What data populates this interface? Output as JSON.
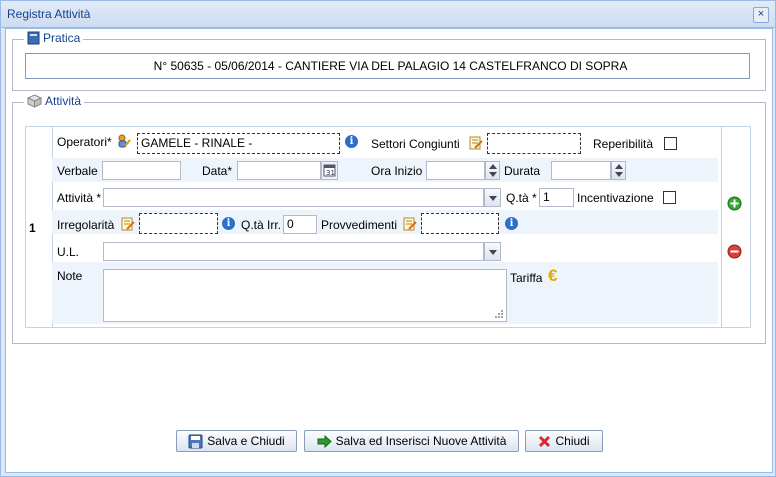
{
  "window": {
    "title": "Registra Attività",
    "close_glyph": "×"
  },
  "pratica": {
    "legend": "Pratica",
    "value": "N° 50635 - 05/06/2014 - CANTIERE VIA DEL PALAGIO  14 CASTELFRANCO DI SOPRA"
  },
  "attivita_section": {
    "legend": "Attività",
    "row_number": "1",
    "fields": {
      "operatori_label": "Operatori*",
      "operatori_value": "GAMELE - RINALE -",
      "settori_label": "Settori Congiunti",
      "settori_value": "",
      "reperibilita_label": "Reperibilità",
      "verbale_label": "Verbale",
      "verbale_value": "",
      "data_label": "Data*",
      "data_value": "",
      "ora_inizio_label": "Ora Inizio",
      "ora_inizio_value": "",
      "durata_label": "Durata",
      "durata_value": "",
      "attivita_label": "Attività *",
      "attivita_value": "",
      "qta_label": "Q.tà *",
      "qta_value": "1",
      "incentivazione_label": "Incentivazione",
      "irregolarita_label": "Irregolarità",
      "irregolarita_value": "",
      "qta_irr_label": "Q.tà Irr.",
      "qta_irr_value": "0",
      "provvedimenti_label": "Provvedimenti",
      "provvedimenti_value": "",
      "ul_label": "U.L.",
      "ul_value": "",
      "note_label": "Note",
      "note_value": "",
      "tariffa_label": "Tariffa",
      "tariffa_glyph": "€"
    },
    "checkbox_states": {
      "reperibilita": false,
      "incentivazione": false
    }
  },
  "buttons": {
    "save_close": "Salva e Chiudi",
    "save_insert": "Salva ed Inserisci Nuove Attività",
    "close": "Chiudi"
  },
  "colors": {
    "title_text": "#15428b",
    "add": "#3aa33a",
    "remove": "#d9413a",
    "close_x": "#d42a2a",
    "arrow": "#2a9a2a",
    "tariffa": "#e0a800"
  }
}
